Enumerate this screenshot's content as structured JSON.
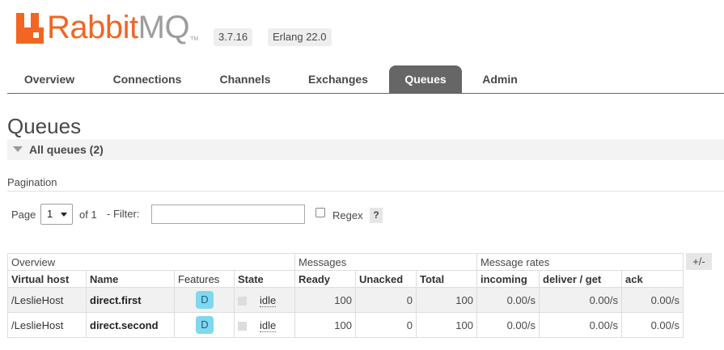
{
  "header": {
    "logo_rabbit": "Rabbit",
    "logo_mq": "MQ",
    "logo_tm": "TM",
    "version": "3.7.16",
    "erlang": "Erlang 22.0"
  },
  "tabs": [
    {
      "label": "Overview"
    },
    {
      "label": "Connections"
    },
    {
      "label": "Channels"
    },
    {
      "label": "Exchanges"
    },
    {
      "label": "Queues"
    },
    {
      "label": "Admin"
    }
  ],
  "active_tab": "Queues",
  "page": {
    "title": "Queues",
    "section_title": "All queues (2)"
  },
  "pagination": {
    "label": "Pagination",
    "page_label": "Page",
    "page_value": "1",
    "of_label": "of 1",
    "filter_label": "- Filter:",
    "filter_value": "",
    "regex_label": "Regex",
    "regex_checked": false,
    "help": "?"
  },
  "table": {
    "groups": [
      "Overview",
      "Messages",
      "Message rates"
    ],
    "columns": [
      "Virtual host",
      "Name",
      "Features",
      "State",
      "Ready",
      "Unacked",
      "Total",
      "incoming",
      "deliver / get",
      "ack"
    ],
    "rows": [
      {
        "vhost": "/LeslieHost",
        "name": "direct.first",
        "features": "D",
        "state": "idle",
        "ready": "100",
        "unacked": "0",
        "total": "100",
        "incoming": "0.00/s",
        "deliver_get": "0.00/s",
        "ack": "0.00/s"
      },
      {
        "vhost": "/LeslieHost",
        "name": "direct.second",
        "features": "D",
        "state": "idle",
        "ready": "100",
        "unacked": "0",
        "total": "100",
        "incoming": "0.00/s",
        "deliver_get": "0.00/s",
        "ack": "0.00/s"
      }
    ],
    "plus_minus": "+/-"
  },
  "colors": {
    "brand": "#f26522",
    "active_tab_bg": "#666666",
    "feature_badge": "#80d7ee"
  }
}
